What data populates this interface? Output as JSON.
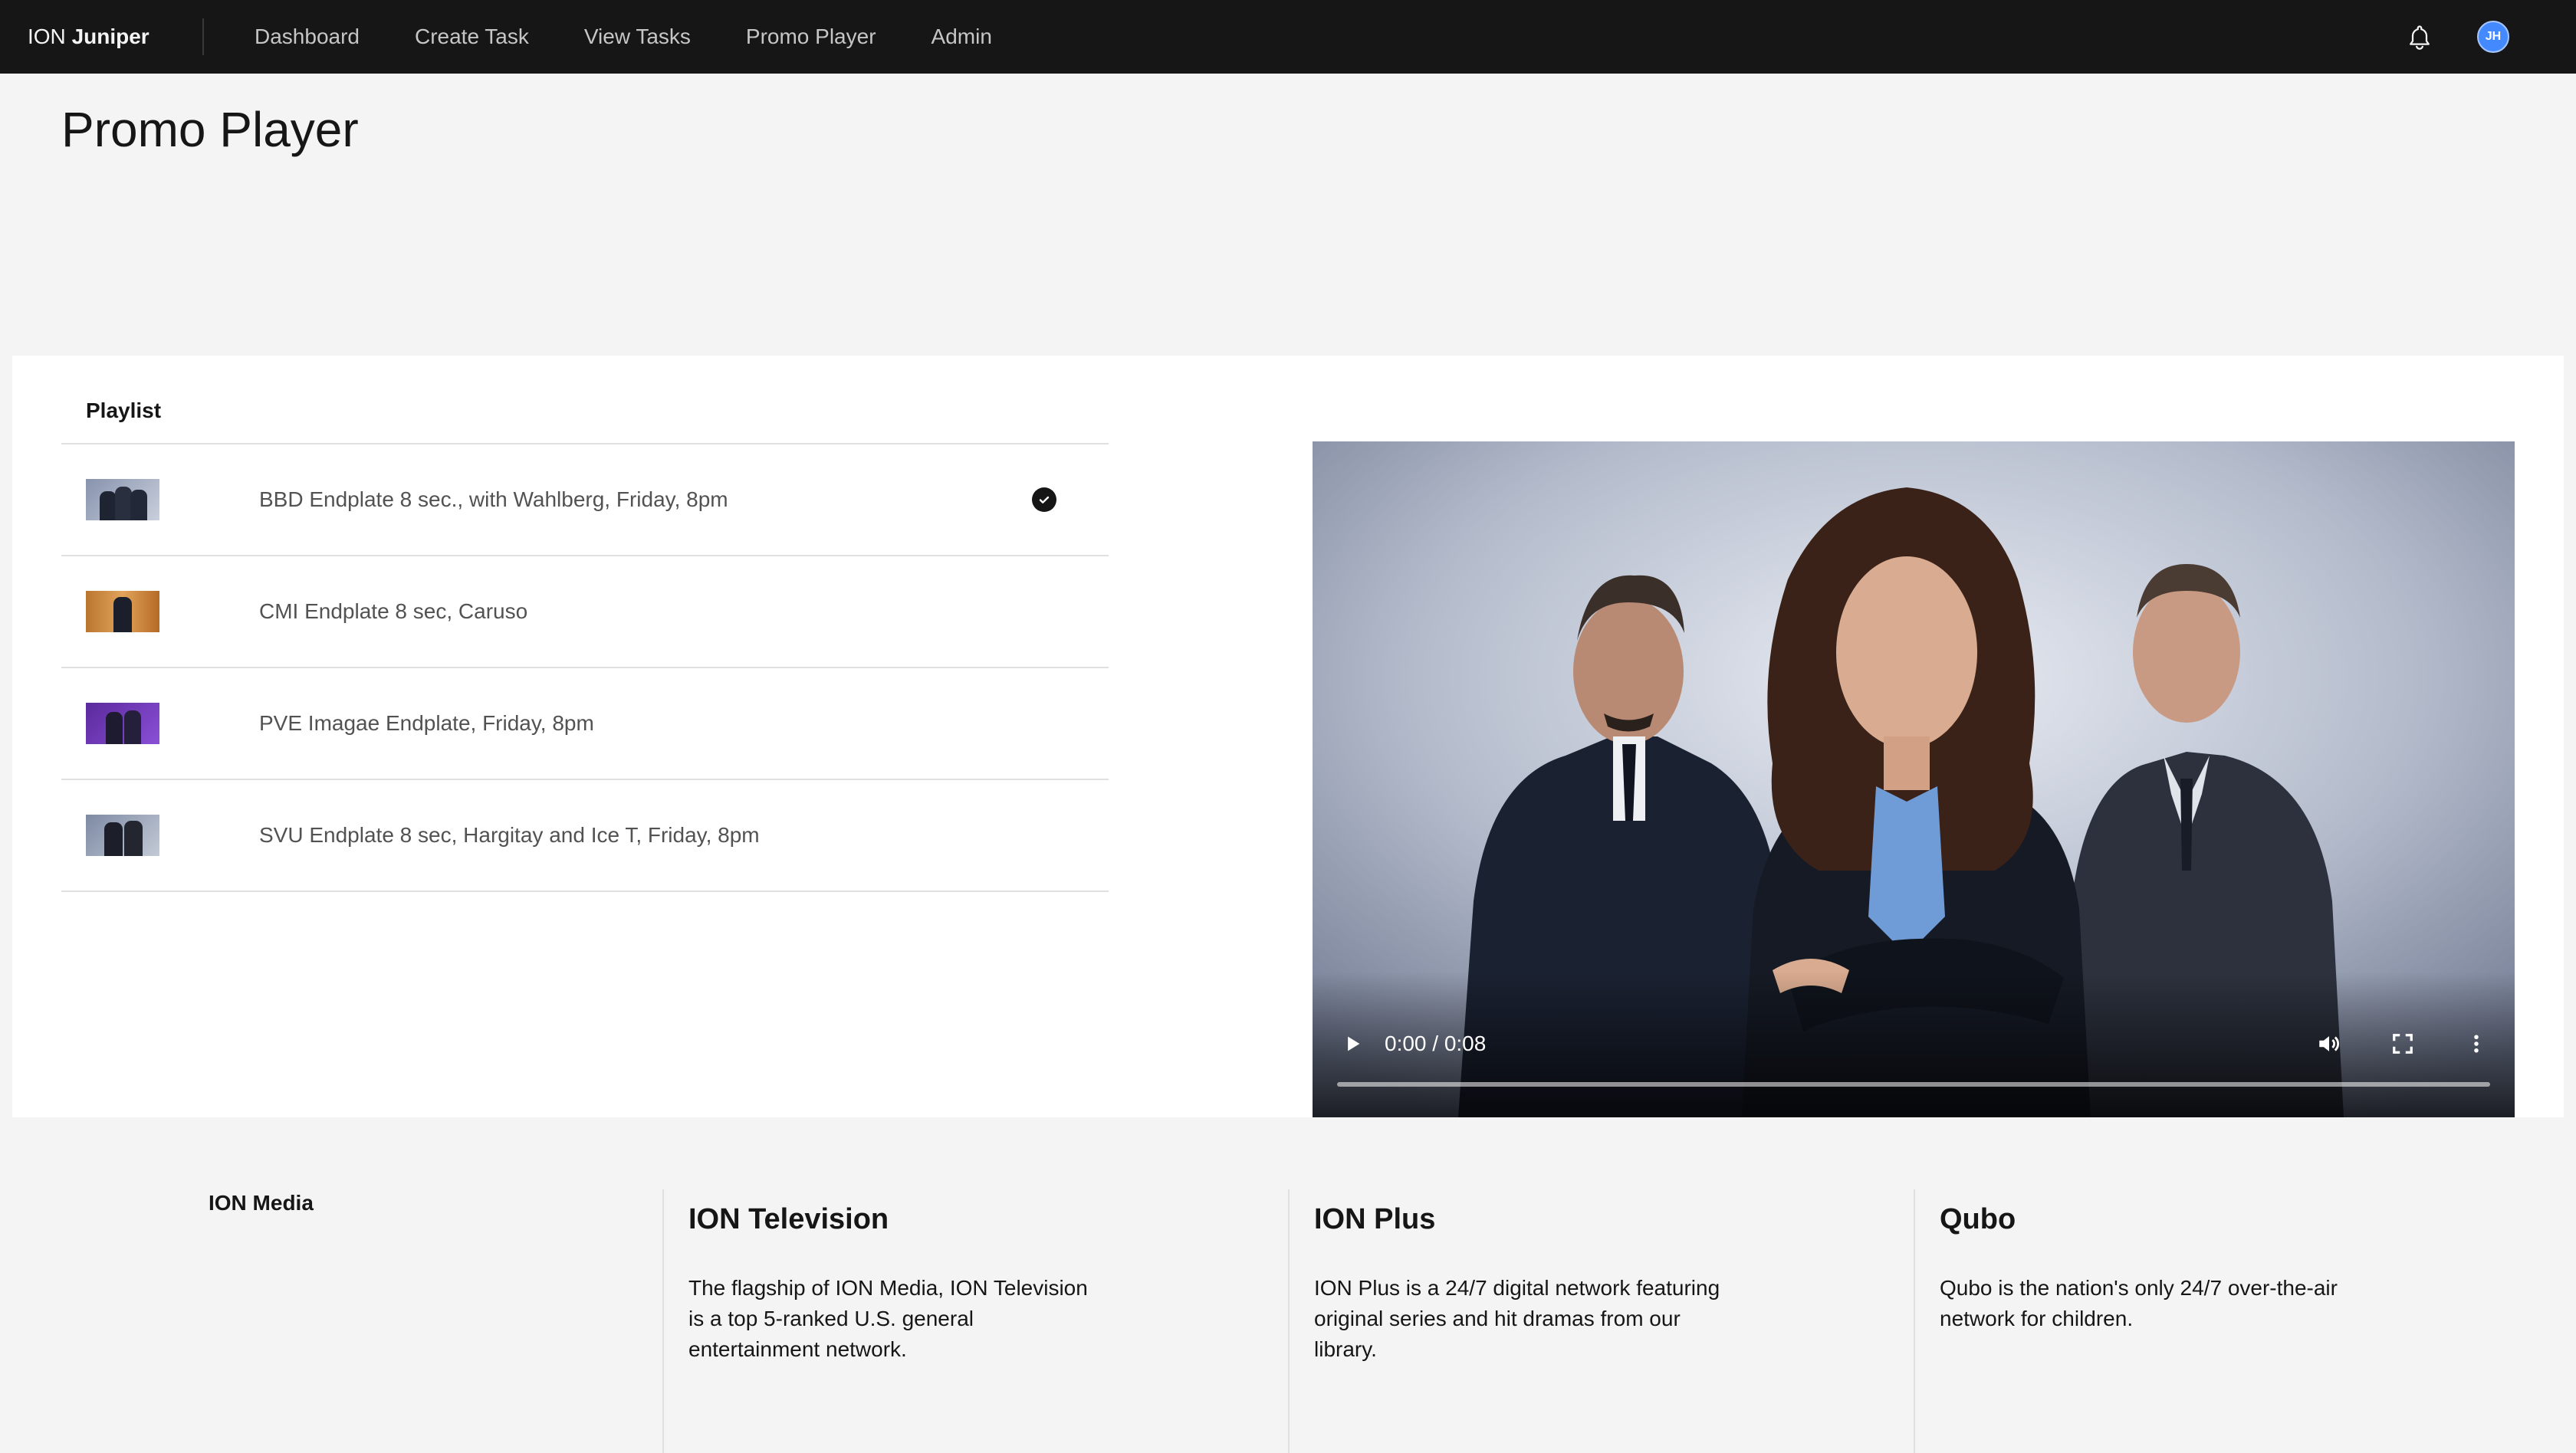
{
  "header": {
    "brand_prefix": "ION",
    "brand_name": "Juniper",
    "nav": [
      "Dashboard",
      "Create Task",
      "View Tasks",
      "Promo Player",
      "Admin"
    ],
    "notification_icon": "bell-icon",
    "avatar_initials": "JH",
    "avatar_color": "#4589ff"
  },
  "page": {
    "title": "Promo Player"
  },
  "playlist": {
    "title": "Playlist",
    "items": [
      {
        "label": "BBD Endplate 8 sec., with Wahlberg, Friday, 8pm",
        "selected": true
      },
      {
        "label": "CMI Endplate 8 sec, Caruso",
        "selected": false
      },
      {
        "label": "PVE Imagae Endplate, Friday, 8pm",
        "selected": false
      },
      {
        "label": "SVU Endplate 8 sec, Hargitay and Ice T, Friday, 8pm",
        "selected": false
      }
    ],
    "selected_icon": "checkmark-filled-icon"
  },
  "player": {
    "time": "0:00 / 0:08",
    "progress": 0,
    "icons": [
      "play-icon",
      "volume-icon",
      "fullscreen-icon",
      "more-options-icon"
    ]
  },
  "footer": {
    "brand": "ION Media",
    "columns": [
      {
        "title": "ION Television",
        "text": "The flagship of ION Media, ION Television is a top 5-ranked U.S. general entertainment network."
      },
      {
        "title": "ION Plus",
        "text": "ION Plus is a 24/7 digital network featuring original series and hit dramas from our library."
      },
      {
        "title": "Qubo",
        "text": "Qubo is the nation's only 24/7 over-the-air network for children."
      }
    ]
  }
}
